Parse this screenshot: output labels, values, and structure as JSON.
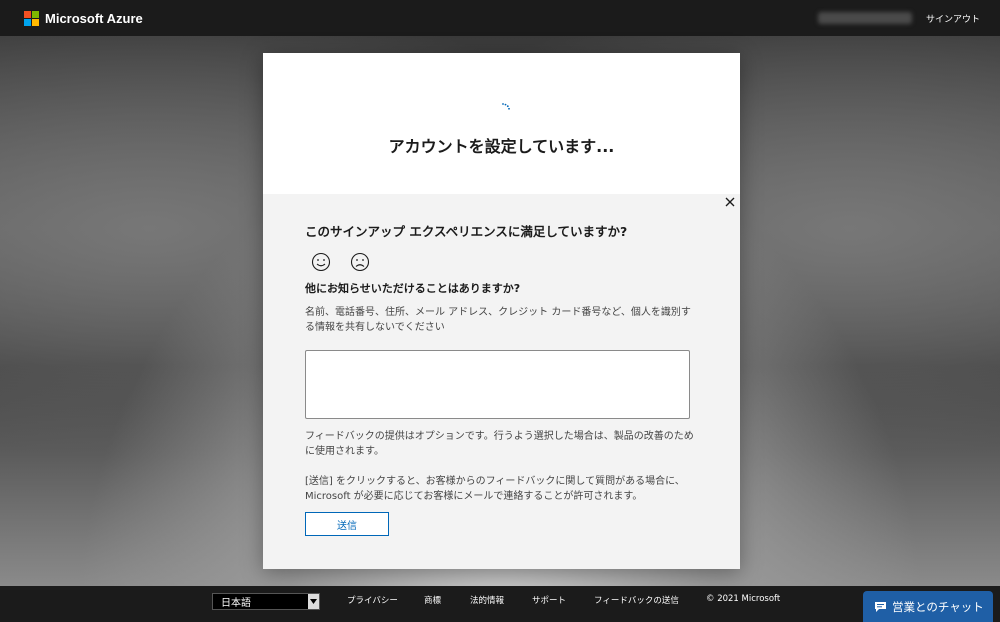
{
  "header": {
    "brand": "Microsoft Azure",
    "signout_label": "サインアウト"
  },
  "status": {
    "title": "アカウントを設定しています..."
  },
  "feedback": {
    "question": "このサインアップ エクスペリエンスに満足していますか?",
    "faces": [
      "smile-icon",
      "frown-icon"
    ],
    "question2": "他にお知らせいただけることはありますか?",
    "hint": "名前、電話番号、住所、メール アドレス、クレジット カード番号など、個人を識別する情報を共有しないでください",
    "textarea_value": "",
    "note_optional": "フィードバックの提供はオプションです。行うよう選択した場合は、製品の改善のために使用されます。",
    "note_consent": "[送信] をクリックすると、お客様からのフィードバックに関して質問がある場合に、Microsoft が必要に応じてお客様にメールで連絡することが許可されます。",
    "send_label": "送信"
  },
  "footer": {
    "language": "日本語",
    "links": [
      "プライバシー",
      "商標",
      "法的情報",
      "サポート",
      "フィードバックの送信"
    ],
    "copyright": "© 2021 Microsoft",
    "chat_label": "営業とのチャット"
  },
  "colors": {
    "accent": "#0067b8",
    "chat": "#1f5fa6",
    "topbar": "#1b1b1b"
  }
}
